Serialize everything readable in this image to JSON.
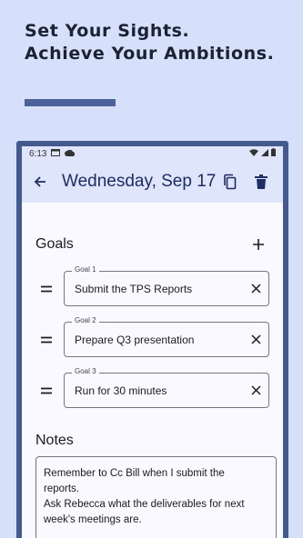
{
  "promo": {
    "headline_line1": "Set Your Sights.",
    "headline_line2": "Achieve Your Ambitions."
  },
  "status_bar": {
    "time": "6:13",
    "icons": [
      "calendar-icon",
      "cloud-icon",
      "wifi-icon",
      "signal-icon",
      "battery-icon"
    ]
  },
  "app_bar": {
    "title": "Wednesday, Sep 17",
    "icons": [
      "back-arrow-icon",
      "copy-icon",
      "delete-icon"
    ]
  },
  "goals": {
    "title": "Goals",
    "items": [
      {
        "label": "Goal 1",
        "value": "Submit the TPS Reports"
      },
      {
        "label": "Goal 2",
        "value": "Prepare Q3 presentation"
      },
      {
        "label": "Goal 3",
        "value": "Run for 30 minutes"
      }
    ]
  },
  "notes": {
    "title": "Notes",
    "lines": [
      "Remember to Cc Bill when I submit the",
      "reports.",
      "Ask Rebecca what the deliverables for next",
      "week's meetings are."
    ]
  },
  "colors": {
    "background": "#d7e0fb",
    "frame": "#44598e",
    "app_bar": "#dfe5fa",
    "title_text": "#1e2d63"
  }
}
